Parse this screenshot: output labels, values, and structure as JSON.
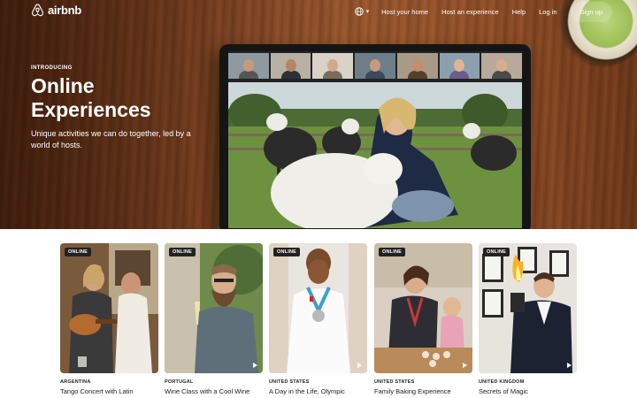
{
  "nav": {
    "brand": "airbnb",
    "links": [
      "Host your home",
      "Host an experience",
      "Help",
      "Log in"
    ],
    "signup": "Sign up",
    "language_icon": "globe-icon"
  },
  "hero": {
    "eyebrow": "INTRODUCING",
    "title": "Online Experiences",
    "subtitle": "Unique activities we can do together, led by a world of hosts."
  },
  "colors": {
    "text": "#222222",
    "badge_bg": "#222222",
    "hero_wood": "#8a4a26"
  },
  "experiences": [
    {
      "badge": "ONLINE",
      "country": "ARGENTINA",
      "title": "Tango Concert with Latin"
    },
    {
      "badge": "ONLINE",
      "country": "PORTUGAL",
      "title": "Wine Class with a Cool Wine"
    },
    {
      "badge": "ONLINE",
      "country": "UNITED STATES",
      "title": "A Day in the Life, Olympic"
    },
    {
      "badge": "ONLINE",
      "country": "UNITED STATES",
      "title": "Family Baking Experience"
    },
    {
      "badge": "ONLINE",
      "country": "UNITED KINGDOM",
      "title": "Secrets of Magic"
    }
  ]
}
